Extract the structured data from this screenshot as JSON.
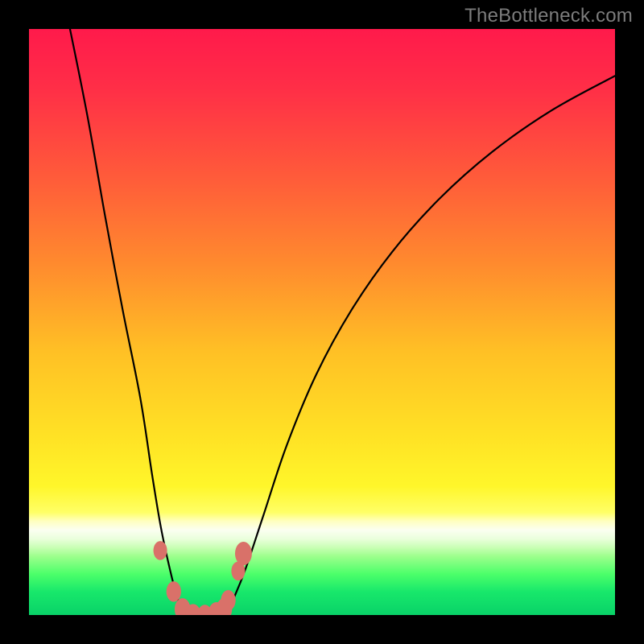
{
  "watermark": "TheBottleneck.com",
  "colors": {
    "frame": "#000000",
    "curve": "#000000",
    "marker_fill": "#d97169",
    "gradient_stops": [
      {
        "offset": 0.0,
        "color": "#ff1a4b"
      },
      {
        "offset": 0.1,
        "color": "#ff2e47"
      },
      {
        "offset": 0.25,
        "color": "#ff5a3a"
      },
      {
        "offset": 0.4,
        "color": "#ff8a2e"
      },
      {
        "offset": 0.55,
        "color": "#ffc025"
      },
      {
        "offset": 0.7,
        "color": "#ffe325"
      },
      {
        "offset": 0.78,
        "color": "#fff62a"
      },
      {
        "offset": 0.825,
        "color": "#ffff66"
      },
      {
        "offset": 0.84,
        "color": "#ffffc0"
      },
      {
        "offset": 0.855,
        "color": "#fbfff1"
      },
      {
        "offset": 0.87,
        "color": "#eaffdc"
      },
      {
        "offset": 0.885,
        "color": "#c8ffb4"
      },
      {
        "offset": 0.9,
        "color": "#9cff8c"
      },
      {
        "offset": 0.93,
        "color": "#4cff6a"
      },
      {
        "offset": 0.96,
        "color": "#18e86b"
      },
      {
        "offset": 1.0,
        "color": "#09d268"
      }
    ]
  },
  "chart_data": {
    "type": "line",
    "title": "",
    "xlabel": "",
    "ylabel": "",
    "x_range": [
      0,
      100
    ],
    "y_range": [
      0,
      100
    ],
    "series": [
      {
        "name": "left-branch",
        "x": [
          7,
          10,
          13,
          16,
          19,
          21,
          22.5,
          24,
          25.3,
          26.5
        ],
        "y": [
          100,
          85,
          68,
          52,
          37,
          24,
          15,
          8,
          3,
          0
        ]
      },
      {
        "name": "valley",
        "x": [
          26.5,
          28,
          30,
          32,
          33.5
        ],
        "y": [
          0,
          0,
          0,
          0,
          0
        ]
      },
      {
        "name": "right-branch",
        "x": [
          33.5,
          35,
          37,
          40,
          44,
          49,
          55,
          62,
          70,
          79,
          89,
          100
        ],
        "y": [
          0,
          3,
          8,
          17,
          29,
          41,
          52,
          62,
          71,
          79,
          86,
          92
        ]
      }
    ],
    "markers": [
      {
        "x": 22.4,
        "y": 11.0,
        "r": 1.3
      },
      {
        "x": 24.7,
        "y": 4.0,
        "r": 1.4
      },
      {
        "x": 26.2,
        "y": 1.0,
        "r": 1.5
      },
      {
        "x": 28.0,
        "y": 0.0,
        "r": 1.5
      },
      {
        "x": 30.0,
        "y": 0.0,
        "r": 1.4
      },
      {
        "x": 32.0,
        "y": 0.2,
        "r": 1.6
      },
      {
        "x": 33.3,
        "y": 1.0,
        "r": 1.5
      },
      {
        "x": 34.0,
        "y": 2.5,
        "r": 1.4
      },
      {
        "x": 35.7,
        "y": 7.5,
        "r": 1.3
      },
      {
        "x": 36.6,
        "y": 10.5,
        "r": 1.6
      }
    ]
  }
}
